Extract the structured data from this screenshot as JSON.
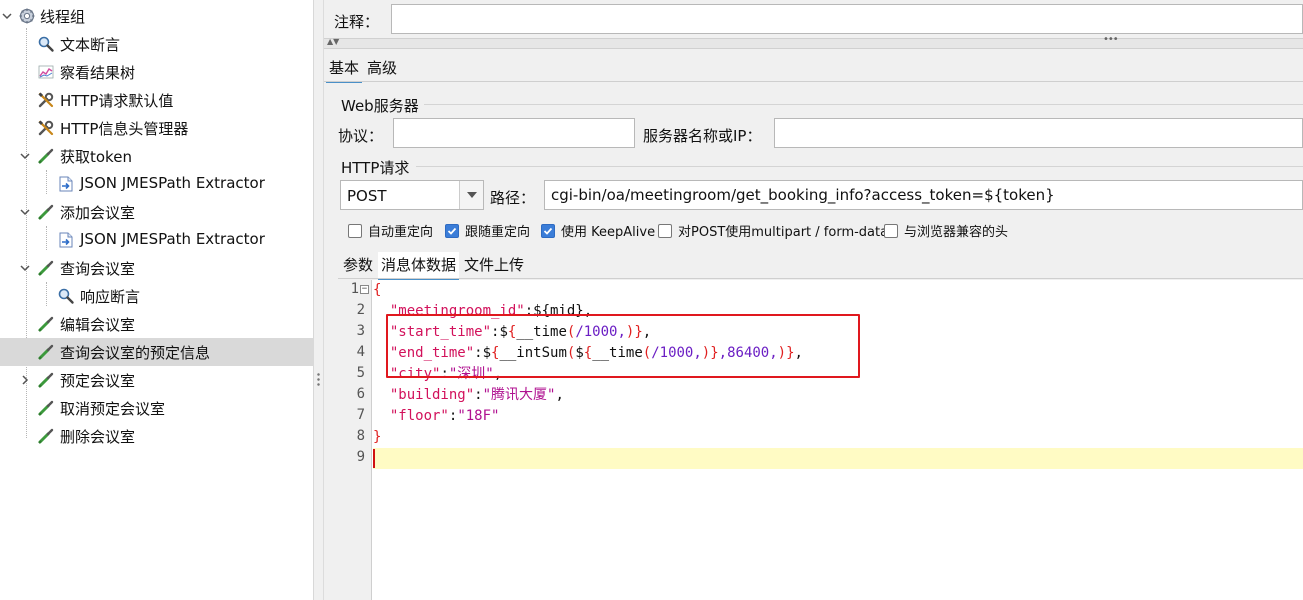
{
  "tree": {
    "items": [
      {
        "label": "线程组",
        "icon": "gear-icon",
        "level": 0,
        "expand": "open"
      },
      {
        "label": "文本断言",
        "icon": "magnifier-icon",
        "level": 1,
        "expand": "none"
      },
      {
        "label": "察看结果树",
        "icon": "chart-icon",
        "level": 1,
        "expand": "none"
      },
      {
        "label": "HTTP请求默认值",
        "icon": "wrench-icon",
        "level": 1,
        "expand": "none"
      },
      {
        "label": "HTTP信息头管理器",
        "icon": "wrench-icon",
        "level": 1,
        "expand": "none"
      },
      {
        "label": "获取token",
        "icon": "pipette-icon",
        "level": 1,
        "expand": "open"
      },
      {
        "label": "JSON JMESPath Extractor",
        "icon": "extractor-icon",
        "level": 2,
        "expand": "none"
      },
      {
        "label": "添加会议室",
        "icon": "pipette-icon",
        "level": 1,
        "expand": "open"
      },
      {
        "label": "JSON JMESPath Extractor",
        "icon": "extractor-icon",
        "level": 2,
        "expand": "none"
      },
      {
        "label": "查询会议室",
        "icon": "pipette-icon",
        "level": 1,
        "expand": "open"
      },
      {
        "label": "响应断言",
        "icon": "magnifier-icon",
        "level": 2,
        "expand": "none"
      },
      {
        "label": "编辑会议室",
        "icon": "pipette-icon",
        "level": 1,
        "expand": "none"
      },
      {
        "label": "查询会议室的预定信息",
        "icon": "pipette-icon",
        "level": 1,
        "expand": "none",
        "selected": true
      },
      {
        "label": "预定会议室",
        "icon": "pipette-icon",
        "level": 1,
        "expand": "closed"
      },
      {
        "label": "取消预定会议室",
        "icon": "pipette-icon",
        "level": 1,
        "expand": "none"
      },
      {
        "label": "删除会议室",
        "icon": "pipette-icon",
        "level": 1,
        "expand": "none"
      }
    ]
  },
  "comment": {
    "label": "注释：",
    "value": ""
  },
  "main_tabs": {
    "basic": "基本",
    "advanced": "高级"
  },
  "web_server": {
    "section_title": "Web服务器",
    "protocol_label": "协议：",
    "protocol_value": "",
    "server_label": "服务器名称或IP：",
    "server_value": ""
  },
  "http_request": {
    "section_title": "HTTP请求",
    "method": "POST",
    "path_label": "路径：",
    "path_value": "cgi-bin/oa/meetingroom/get_booking_info?access_token=${token}"
  },
  "options": [
    {
      "label": "自动重定向",
      "checked": false
    },
    {
      "label": "跟随重定向",
      "checked": true
    },
    {
      "label": "使用 KeepAlive",
      "checked": true
    },
    {
      "label": "对POST使用multipart / form-data",
      "checked": false
    },
    {
      "label": "与浏览器兼容的头",
      "checked": false
    }
  ],
  "body_tabs": {
    "params": "参数",
    "body_data": "消息体数据",
    "files": "文件上传"
  },
  "editor": {
    "line_numbers": [
      "1",
      "2",
      "3",
      "4",
      "5",
      "6",
      "7",
      "8",
      "9"
    ],
    "current_line": 9,
    "fold_marker": "⊟"
  },
  "colors": {
    "selected_row": "#d9d9d9",
    "panel_bg": "#f0f0f0",
    "highlight_box": "#e0181e",
    "current_line": "#fffbc4",
    "checkbox_on": "#3b7dd8"
  }
}
